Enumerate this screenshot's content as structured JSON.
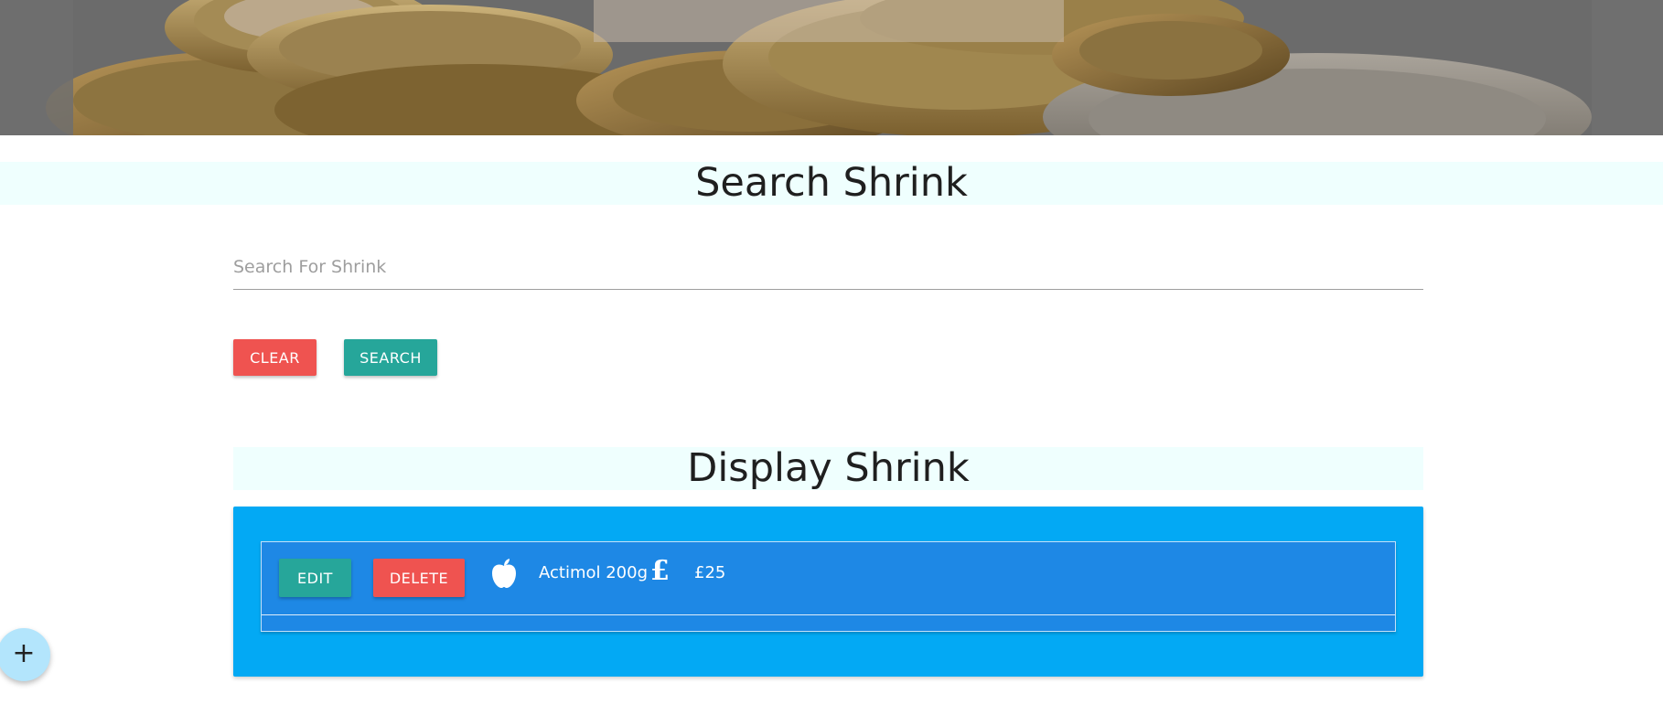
{
  "hero": {
    "image": "coins-banner"
  },
  "search_section": {
    "title": "Search Shrink",
    "search_placeholder": "Search For Shrink",
    "search_value": "",
    "clear_label": "CLEAR",
    "search_label": "SEARCH"
  },
  "display_section": {
    "title": "Display Shrink",
    "items": [
      {
        "edit_label": "EDIT",
        "delete_label": "DELETE",
        "item_icon": "apple-icon",
        "name": "Actimol 200g",
        "price_icon": "pound-icon",
        "price": "£25"
      }
    ]
  },
  "fab": {
    "label": "+",
    "icon": "plus-icon"
  },
  "colors": {
    "red": "#ef5350",
    "teal": "#26a69a",
    "card_blue": "#03a9f4",
    "list_blue": "#1e88e5",
    "title_band": "#effffe",
    "fab": "#b3e5fc"
  }
}
